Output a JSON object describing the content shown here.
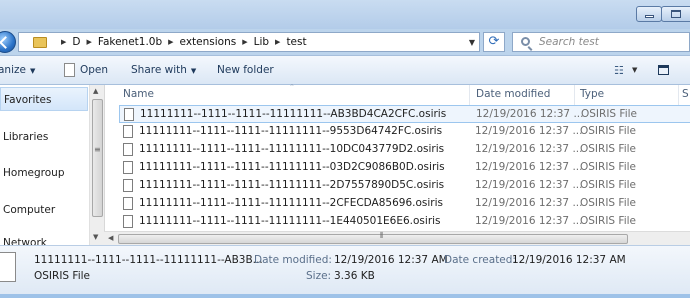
{
  "window": {
    "minimize_label": "minimize",
    "maximize_label": "maximize"
  },
  "address": {
    "breadcrumbs": [
      "D",
      "Fakenet1.0b",
      "extensions",
      "Lib",
      "test"
    ],
    "search_placeholder": "Search test"
  },
  "toolbar": {
    "organize_label": "anize",
    "open_label": "Open",
    "share_label": "Share with",
    "newfolder_label": "New folder"
  },
  "nav": {
    "items": [
      "Favorites",
      "Libraries",
      "Homegroup",
      "Computer",
      "Network"
    ]
  },
  "columns": {
    "name": "Name",
    "date": "Date modified",
    "type": "Type",
    "size": "S"
  },
  "files": [
    {
      "name": "11111111--1111--1111--11111111--AB3BD4CA2CFC.osiris",
      "date": "12/19/2016 12:37 ...",
      "type": "OSIRIS File"
    },
    {
      "name": "11111111--1111--1111--11111111--9553D64742FC.osiris",
      "date": "12/19/2016 12:37 ...",
      "type": "OSIRIS File"
    },
    {
      "name": "11111111--1111--1111--11111111--10DC043779D2.osiris",
      "date": "12/19/2016 12:37 ...",
      "type": "OSIRIS File"
    },
    {
      "name": "11111111--1111--1111--11111111--03D2C9086B0D.osiris",
      "date": "12/19/2016 12:37 ...",
      "type": "OSIRIS File"
    },
    {
      "name": "11111111--1111--1111--11111111--2D7557890D5C.osiris",
      "date": "12/19/2016 12:37 ...",
      "type": "OSIRIS File"
    },
    {
      "name": "11111111--1111--1111--11111111--2CFECDA85696.osiris",
      "date": "12/19/2016 12:37 ...",
      "type": "OSIRIS File"
    },
    {
      "name": "11111111--1111--1111--11111111--1E440501E6E6.osiris",
      "date": "12/19/2016 12:37 ...",
      "type": "OSIRIS File"
    }
  ],
  "details": {
    "filename": "11111111--1111--1111--11111111--AB3B...",
    "filetype": "OSIRIS File",
    "modified_key": "Date modified:",
    "modified_val": "12/19/2016 12:37 AM",
    "size_key": "Size:",
    "size_val": "3.36 KB",
    "created_key": "Date created:",
    "created_val": "12/19/2016 12:37 AM"
  },
  "colors": {
    "selection": "#eef5fd",
    "selection_border": "#9cc6ee",
    "chrome": "#bcd4ec"
  }
}
